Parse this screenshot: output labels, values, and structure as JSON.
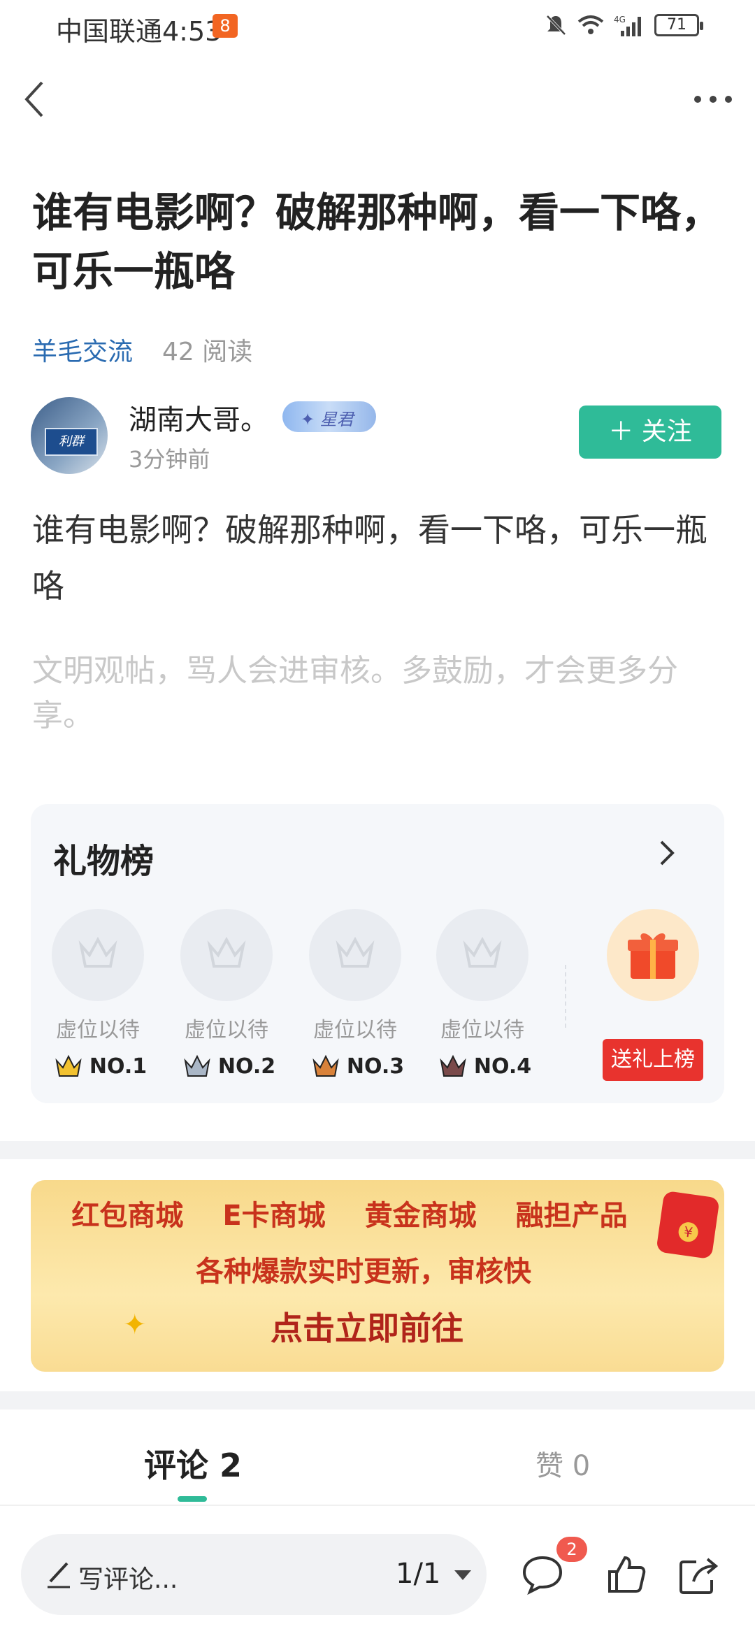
{
  "status_bar": {
    "carrier_time": "中国联通4:53",
    "battery": "71"
  },
  "post": {
    "title": "谁有电影啊？破解那种啊，看一下咯，可乐一瓶咯",
    "category": "羊毛交流",
    "reads": "42 阅读",
    "author": {
      "name": "湖南大哥。",
      "time": "3分钟前"
    },
    "follow_label": "＋ 关注",
    "content": "谁有电影啊？破解那种啊，看一下咯，可乐一瓶咯",
    "hint": "文明观帖，骂人会进审核。多鼓励，才会更多分享。"
  },
  "gift_board": {
    "title": "礼物榜",
    "slots": [
      {
        "label": "虚位以待",
        "rank": "NO.1",
        "color": "#f2c230"
      },
      {
        "label": "虚位以待",
        "rank": "NO.2",
        "color": "#aab7c7"
      },
      {
        "label": "虚位以待",
        "rank": "NO.3",
        "color": "#d9823a"
      },
      {
        "label": "虚位以待",
        "rank": "NO.4",
        "color": "#7a4a4a"
      }
    ],
    "gift_button": "送礼上榜"
  },
  "banner": {
    "line1": [
      "红包商城",
      "E卡商城",
      "黄金商城",
      "融担产品"
    ],
    "line2": "各种爆款实时更新，审核快",
    "line3": "点击立即前往"
  },
  "tabs": {
    "comments": "评论 2",
    "likes": "赞 0"
  },
  "bottom_bar": {
    "input_placeholder": "写评论...",
    "page": "1/1",
    "comment_badge": "2"
  },
  "colors": {
    "accent": "#2fbb98",
    "link": "#2a6bb1",
    "gift_red": "#e8332e"
  }
}
